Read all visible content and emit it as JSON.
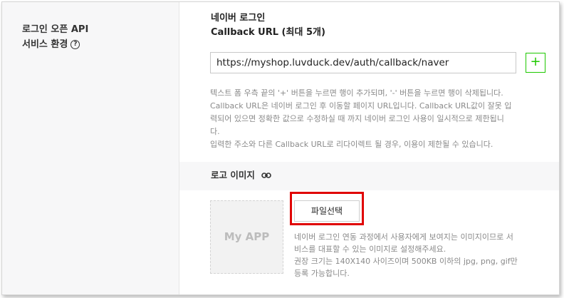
{
  "section": {
    "label_line1": "로그인 오픈 API",
    "label_line2": "서비스 환경",
    "help_icon": "?"
  },
  "callback": {
    "title_line1": "네이버 로그인",
    "title_line2": "Callback URL (최대 5개)",
    "url_value": "https://myshop.luvduck.dev/auth/callback/naver",
    "add_label": "+",
    "help_text": "텍스트 폼 우측 끝의 '+' 버튼을 누르면 행이 추가되며, '-' 버튼을 누르면 행이 삭제됩니다.\nCallback URL은 네이버 로그인 후 이동할 페이지 URL입니다. Callback URL값이 잘못 입\n력되어 있으면 정확한 값으로 수정하실 때 까지 네이버 로그인 사용이 일시적으로 제한됩니\n다.\n입력한 주소와 다른 Callback URL로 리다이렉트 될 경우, 이용이 제한될 수 있습니다."
  },
  "logo": {
    "title": "로고 이미지",
    "link_icon": "link-icon",
    "placeholder": "My APP",
    "file_button": "파일선택",
    "help_text": "네이버 로그인 연동 과정에서 사용자에게 보여지는 이미지이므로 서\n비스를 대표할 수 있는 이미지로 설정해주세요.\n권장 크기는 140X140 사이즈이며 500KB 이하의 jpg, png, gif만\n등록 가능합니다."
  },
  "colors": {
    "accent_green": "#1ec800",
    "highlight_red": "#e00000"
  }
}
